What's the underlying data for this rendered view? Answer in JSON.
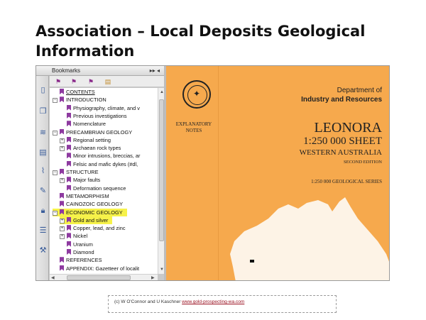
{
  "slide": {
    "title": "Association – Local Deposits Geological Information"
  },
  "bookmarks_panel": {
    "header_label": "Bookmarks",
    "header_controls": "▸▸ ◂",
    "side_icons": [
      "page-icon",
      "pages-icon",
      "layers-icon",
      "comment-icon",
      "attachment-icon",
      "signature-icon",
      "lock-icon",
      "form-icon",
      "tools-icon"
    ],
    "toolbar_icons": [
      "new-bookmark-icon",
      "delete-bookmark-icon",
      "expand-bookmark-icon",
      "options-icon"
    ],
    "tree": [
      {
        "label": "CONTENTS",
        "level": 0,
        "expander": "",
        "underline": true,
        "highlight": false
      },
      {
        "label": "INTRODUCTION",
        "level": 0,
        "expander": "−",
        "underline": false,
        "highlight": false
      },
      {
        "label": "Physiography, climate, and v",
        "level": 1,
        "expander": "",
        "underline": false,
        "highlight": false
      },
      {
        "label": "Previous investigations",
        "level": 1,
        "expander": "",
        "underline": false,
        "highlight": false
      },
      {
        "label": "Nomenclature",
        "level": 1,
        "expander": "",
        "underline": false,
        "highlight": false
      },
      {
        "label": "PRECAMBRIAN GEOLOGY",
        "level": 0,
        "expander": "−",
        "underline": false,
        "highlight": false
      },
      {
        "label": "Regional setting",
        "level": 1,
        "expander": "+",
        "underline": false,
        "highlight": false
      },
      {
        "label": "Archaean rock types",
        "level": 1,
        "expander": "+",
        "underline": false,
        "highlight": false
      },
      {
        "label": "Minor intrusions, breccias, ar",
        "level": 1,
        "expander": "",
        "underline": false,
        "highlight": false
      },
      {
        "label": "Felsic and mafic dykes (#dl,",
        "level": 1,
        "expander": "",
        "underline": false,
        "highlight": false
      },
      {
        "label": "STRUCTURE",
        "level": 0,
        "expander": "−",
        "underline": false,
        "highlight": false
      },
      {
        "label": "Major faults",
        "level": 1,
        "expander": "+",
        "underline": false,
        "highlight": false
      },
      {
        "label": "Deformation sequence",
        "level": 1,
        "expander": "",
        "underline": false,
        "highlight": false
      },
      {
        "label": "METAMORPHISM",
        "level": 0,
        "expander": "",
        "underline": false,
        "highlight": false
      },
      {
        "label": "CAINOZOIC GEOLOGY",
        "level": 0,
        "expander": "",
        "underline": false,
        "highlight": false
      },
      {
        "label": "ECONOMIC GEOLOGY",
        "level": 0,
        "expander": "−",
        "underline": false,
        "highlight": true
      },
      {
        "label": "Gold and silver",
        "level": 1,
        "expander": "+",
        "underline": false,
        "highlight": true
      },
      {
        "label": "Copper, lead, and zinc",
        "level": 1,
        "expander": "+",
        "underline": false,
        "highlight": false
      },
      {
        "label": "Nickel",
        "level": 1,
        "expander": "+",
        "underline": false,
        "highlight": false
      },
      {
        "label": "Uranium",
        "level": 1,
        "expander": "",
        "underline": false,
        "highlight": false
      },
      {
        "label": "Diamond",
        "level": 1,
        "expander": "",
        "underline": false,
        "highlight": false
      },
      {
        "label": "REFERENCES",
        "level": 0,
        "expander": "",
        "underline": false,
        "highlight": false
      },
      {
        "label": "APPENDIX: Gazetteer of localit",
        "level": 0,
        "expander": "",
        "underline": false,
        "highlight": false
      }
    ]
  },
  "document": {
    "explanatory": "EXPLANATORY NOTES",
    "dept_line1": "Department of",
    "dept_line2": "Industry and Resources",
    "sheet_name": "LEONORA",
    "sheet_scale": "1:250 000 SHEET",
    "region": "WESTERN AUSTRALIA",
    "edition": "SECOND EDITION",
    "series": "1:250 000 GEOLOGICAL SERIES",
    "page_color": "#f6a94d",
    "map_color": "#fdf3e6"
  },
  "caption": {
    "credit": "(c) W O'Connor and U Kaschner",
    "link": "www.gold-prospecting-wa.com"
  }
}
